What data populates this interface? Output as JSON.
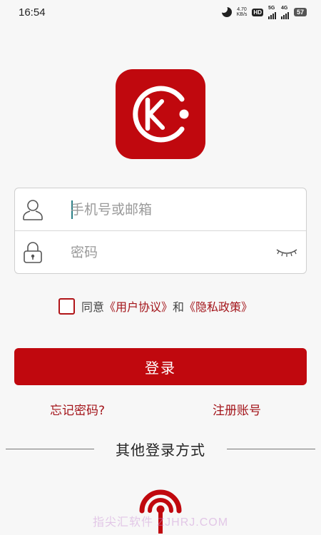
{
  "status_bar": {
    "time": "16:54",
    "net_speed_value": "4.70",
    "net_speed_unit": "KB/s",
    "hd_label": "HD",
    "signal1_label": "5G",
    "signal2_label": "4G",
    "battery": "57"
  },
  "login_form": {
    "account_placeholder": "手机号或邮箱",
    "password_placeholder": "密码"
  },
  "agreement": {
    "prefix": "同意",
    "user_agreement": "《用户协议》",
    "conjunction": "和",
    "privacy_policy": "《隐私政策》"
  },
  "actions": {
    "login_label": "登录",
    "forgot_password": "忘记密码?",
    "register": "注册账号"
  },
  "other_login": {
    "title": "其他登录方式"
  },
  "watermark": "指尖汇软件 ZJHRJ.COM",
  "colors": {
    "brand_red": "#c0080e",
    "link_red": "#a3141a",
    "background": "#f7f7f7"
  },
  "icons": {
    "logo": "kc-logo-icon",
    "account": "user-icon",
    "password": "lock-icon",
    "toggle_visibility": "eye-closed-icon",
    "third_party": "signal-broadcast-icon"
  }
}
